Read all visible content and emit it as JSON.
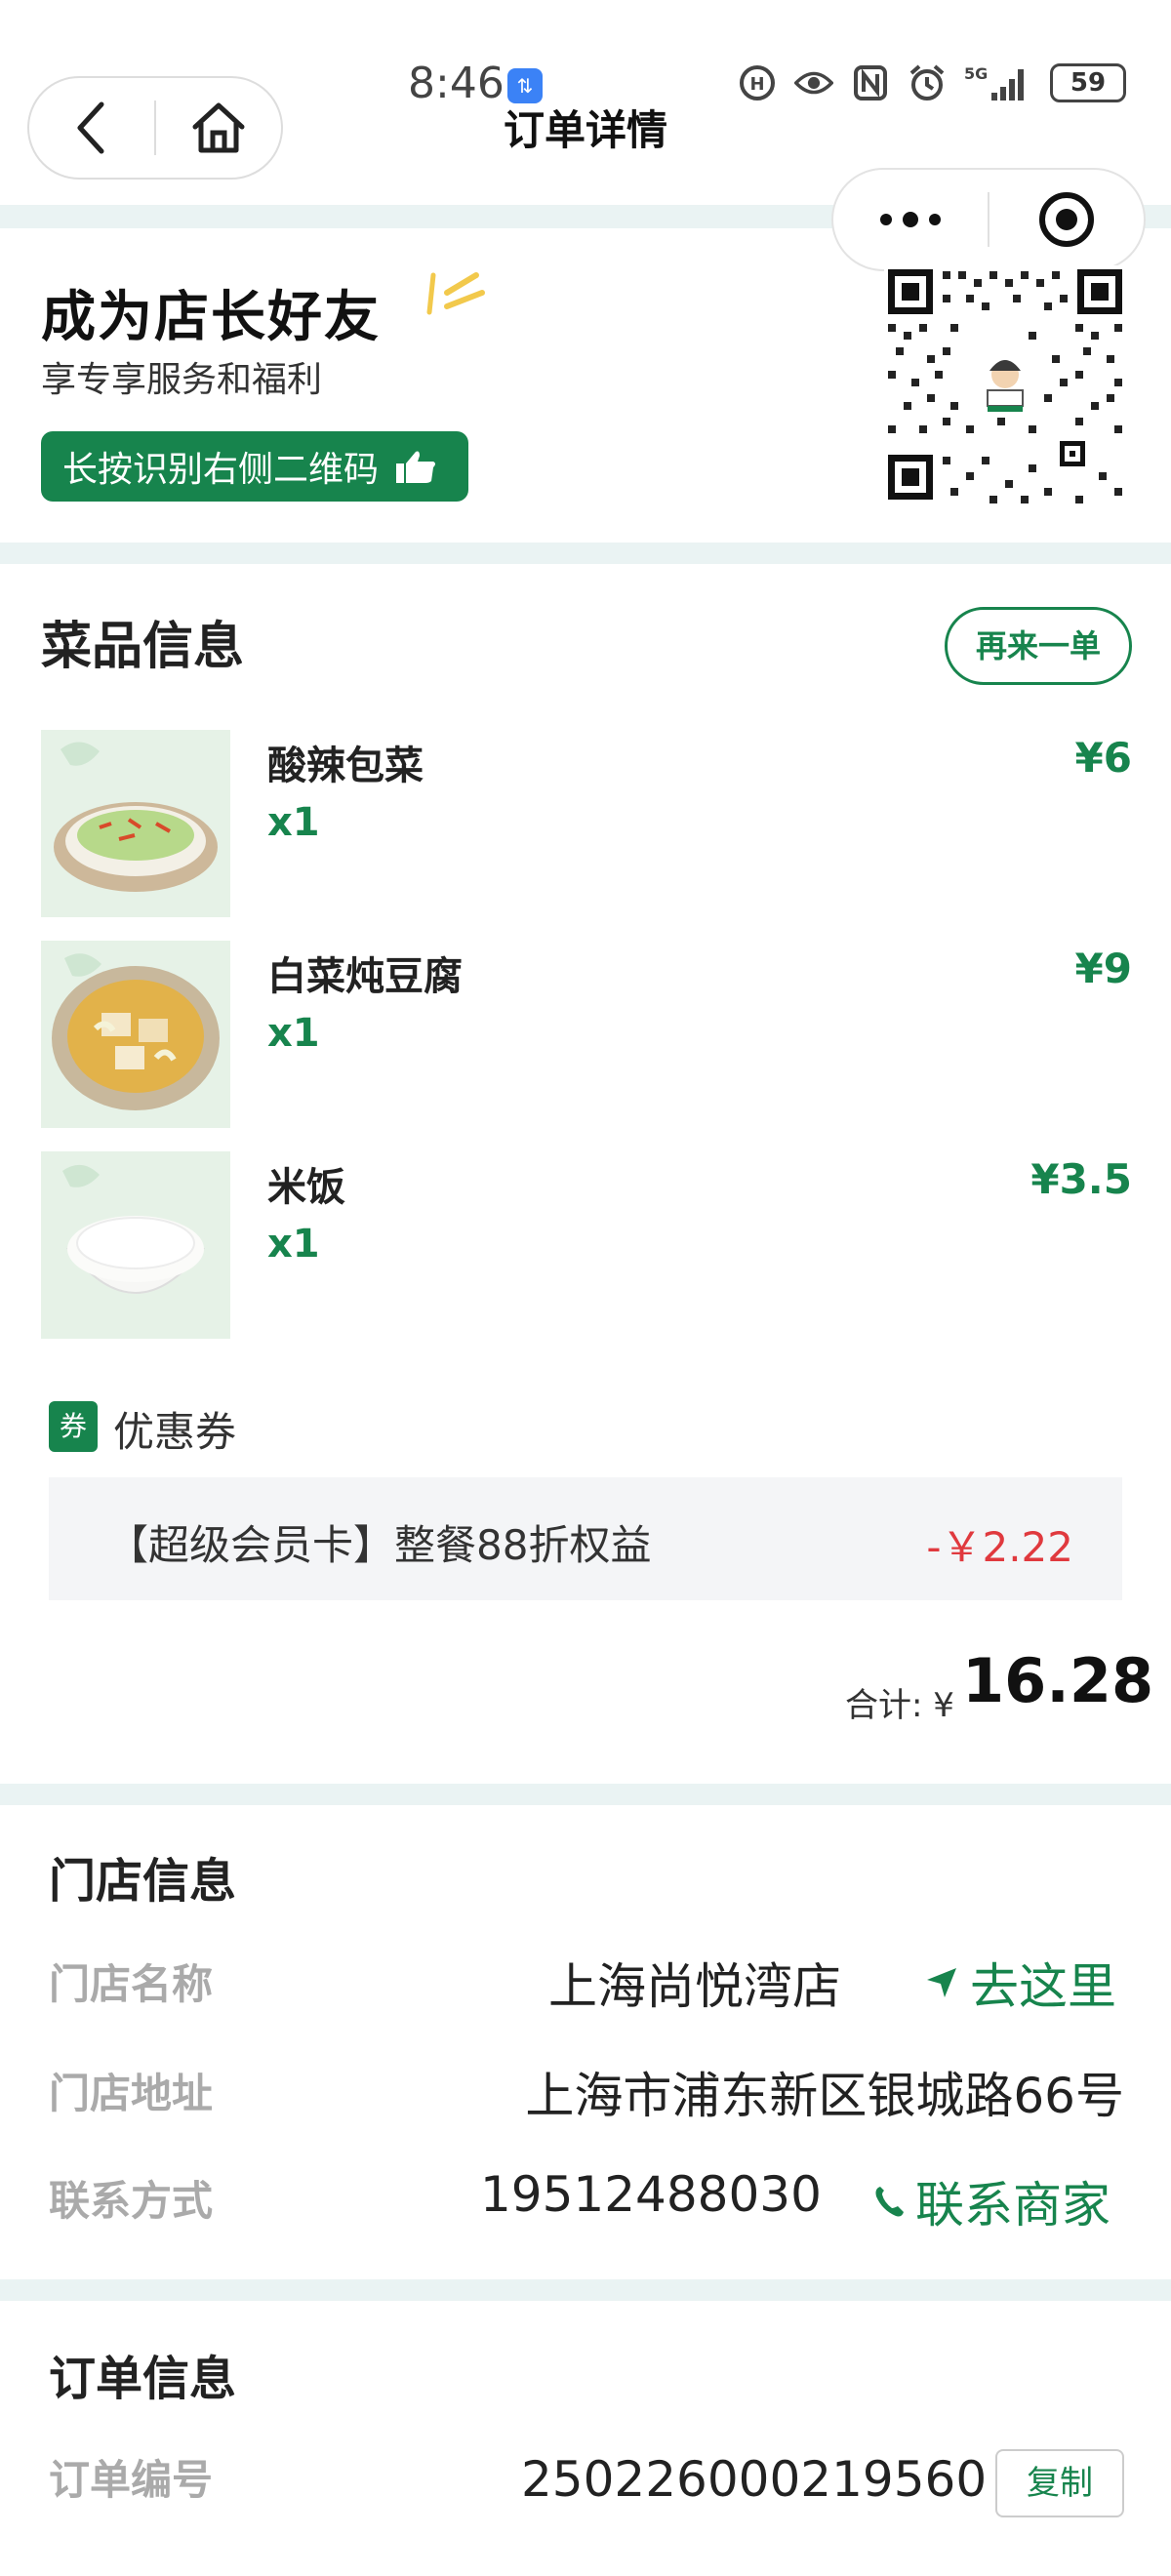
{
  "status_bar": {
    "time": "8:46",
    "battery": "59",
    "network": "5G"
  },
  "nav": {
    "title": "订单详情"
  },
  "promo": {
    "title": "成为店长好友",
    "subtitle": "享专享服务和福利",
    "button_label": "长按识别右侧二维码"
  },
  "dishes": {
    "heading": "菜品信息",
    "reorder_label": "再来一单",
    "items": [
      {
        "name": "酸辣包菜",
        "qty": "x1",
        "price": "¥6"
      },
      {
        "name": "白菜炖豆腐",
        "qty": "x1",
        "price": "¥9"
      },
      {
        "name": "米饭",
        "qty": "x1",
        "price": "¥3.5"
      }
    ],
    "coupon": {
      "tag": "券",
      "label": "优惠券",
      "description": "【超级会员卡】整餐88折权益",
      "amount": "-￥2.22"
    },
    "total": {
      "label": "合计: ¥",
      "value": "16.28"
    }
  },
  "store": {
    "heading": "门店信息",
    "name_label": "门店名称",
    "name_value": "上海尚悦湾店",
    "navigate_label": "去这里",
    "address_label": "门店地址",
    "address_value": "上海市浦东新区银城路66号",
    "contact_label": "联系方式",
    "contact_value": "19512488030",
    "call_label": "联系商家"
  },
  "order": {
    "heading": "订单信息",
    "number_label": "订单编号",
    "number_value": "250226000219560",
    "copy_label": "复制"
  },
  "colors": {
    "accent": "#17844d",
    "discount": "#e0393e",
    "band": "#eaf3f3"
  }
}
